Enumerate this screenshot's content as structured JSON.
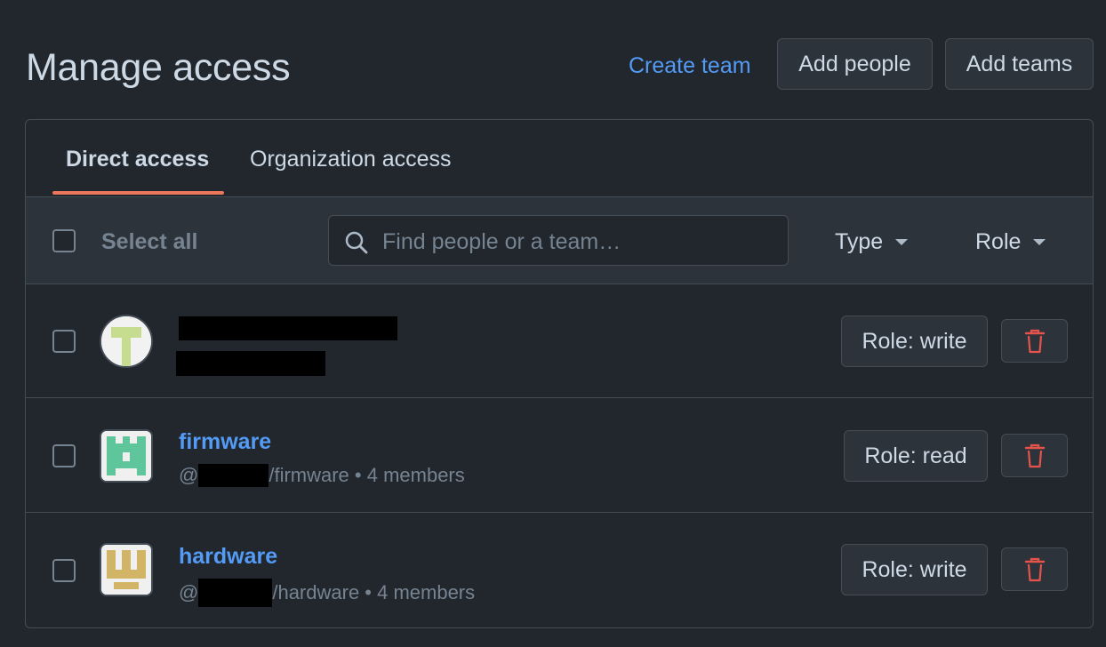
{
  "header": {
    "title": "Manage access",
    "create_team": "Create team",
    "add_people": "Add people",
    "add_teams": "Add teams"
  },
  "tabs": [
    {
      "label": "Direct access",
      "selected": true
    },
    {
      "label": "Organization access",
      "selected": false
    }
  ],
  "toolbar": {
    "select_all": "Select all",
    "search_placeholder": "Find people or a team…",
    "type_label": "Type",
    "role_label": "Role"
  },
  "rows": [
    {
      "kind": "user",
      "role_label": "Role: write"
    },
    {
      "kind": "team",
      "name": "firmware",
      "handle_prefix": "@",
      "handle_suffix": "/firmware • 4 members",
      "role_label": "Role: read"
    },
    {
      "kind": "team",
      "name": "hardware",
      "handle_prefix": "@",
      "handle_suffix": "/hardware • 4 members",
      "role_label": "Role: write"
    }
  ],
  "colors": {
    "accent_link": "#539bf5",
    "tab_underline": "#ec775c",
    "delete": "#e5534b",
    "background": "#22272e"
  },
  "icons": {
    "search": "search-icon",
    "delete": "trash-icon",
    "dropdown": "caret-down-icon"
  }
}
